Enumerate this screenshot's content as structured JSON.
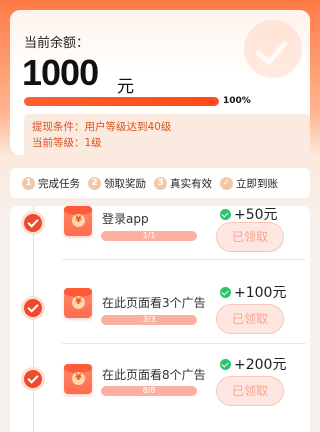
{
  "balance": {
    "label": "当前余额：",
    "amount": "1000",
    "unit": "元",
    "progress_percent": 100,
    "progress_text": "100%",
    "condition_line": "提现条件：用户等级达到40级",
    "current_level_line": "当前等级：1级"
  },
  "steps": [
    {
      "num": "1",
      "label": "完成任务"
    },
    {
      "num": "2",
      "label": "领取奖励"
    },
    {
      "num": "3",
      "label": "真实有效"
    },
    {
      "num": "✓",
      "label": "立即到账"
    }
  ],
  "tasks": [
    {
      "title": "登录app",
      "progress_text": "1/1",
      "reward": "+50元",
      "button": "已领取"
    },
    {
      "title": "在此页面看3个广告",
      "progress_text": "3/3",
      "reward": "+100元",
      "button": "已领取"
    },
    {
      "title": "在此页面看8个广告",
      "progress_text": "8/8",
      "reward": "+200元",
      "button": "已领取"
    }
  ],
  "colors": {
    "accent": "#ff5f2e",
    "reward_icon": "#2bc36b",
    "check": "#f04a2e"
  }
}
